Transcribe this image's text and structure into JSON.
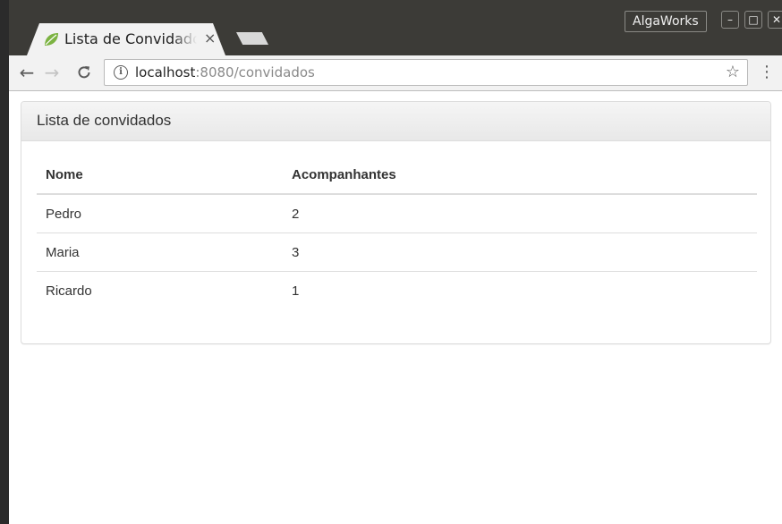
{
  "browser": {
    "tab_title": "Lista de Convidados",
    "tab_close": "×",
    "profile_name": "AlgaWorks",
    "window_controls": {
      "minimize": "–",
      "maximize": "□",
      "close": "✕"
    },
    "nav": {
      "back": "←",
      "forward": "→",
      "reload": "C"
    },
    "url": {
      "host": "localhost",
      "rest": ":8080/convidados"
    },
    "bookmark_icon": "☆",
    "menu_icon": "⋮",
    "info_icon": "i"
  },
  "page": {
    "panel_title": "Lista de convidados",
    "table": {
      "headers": [
        "Nome",
        "Acompanhantes"
      ],
      "rows": [
        [
          "Pedro",
          "2"
        ],
        [
          "Maria",
          "3"
        ],
        [
          "Ricardo",
          "1"
        ]
      ]
    }
  },
  "colors": {
    "titlebar": "#3c3b37",
    "toolbar": "#f2f2f2",
    "tab_leaf": "#8bc34a"
  }
}
